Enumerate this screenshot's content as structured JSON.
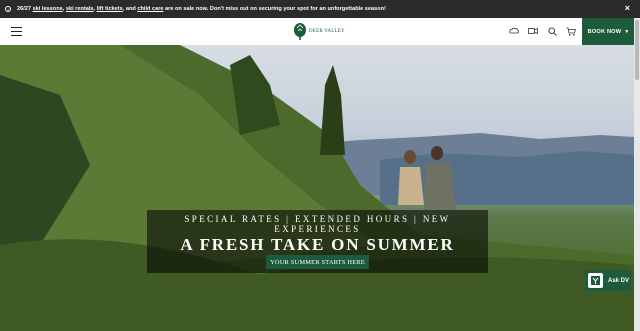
{
  "promo": {
    "prefix": "26/27 ",
    "link1": "ski lessons",
    "sep1": ", ",
    "link2": "ski rentals",
    "sep2": ", ",
    "link3": "lift tickets",
    "sep3": ", and ",
    "link4": "child care",
    "suffix": " are on sale now. Don't miss out on securing your spot for an unforgettable season!",
    "close_label": "×"
  },
  "header": {
    "logo_text": "DEER VALLEY",
    "book_now": "BOOK NOW"
  },
  "hero": {
    "kicker": "SPECIAL RATES | EXTENDED HOURS | NEW EXPERIENCES",
    "headline": "A FRESH TAKE ON SUMMER",
    "cta": "YOUR SUMMER STARTS HERE"
  },
  "chat": {
    "label": "Ask DV"
  },
  "colors": {
    "brand_green": "#1e5a3c",
    "promo_bg": "#2b2b2b"
  }
}
